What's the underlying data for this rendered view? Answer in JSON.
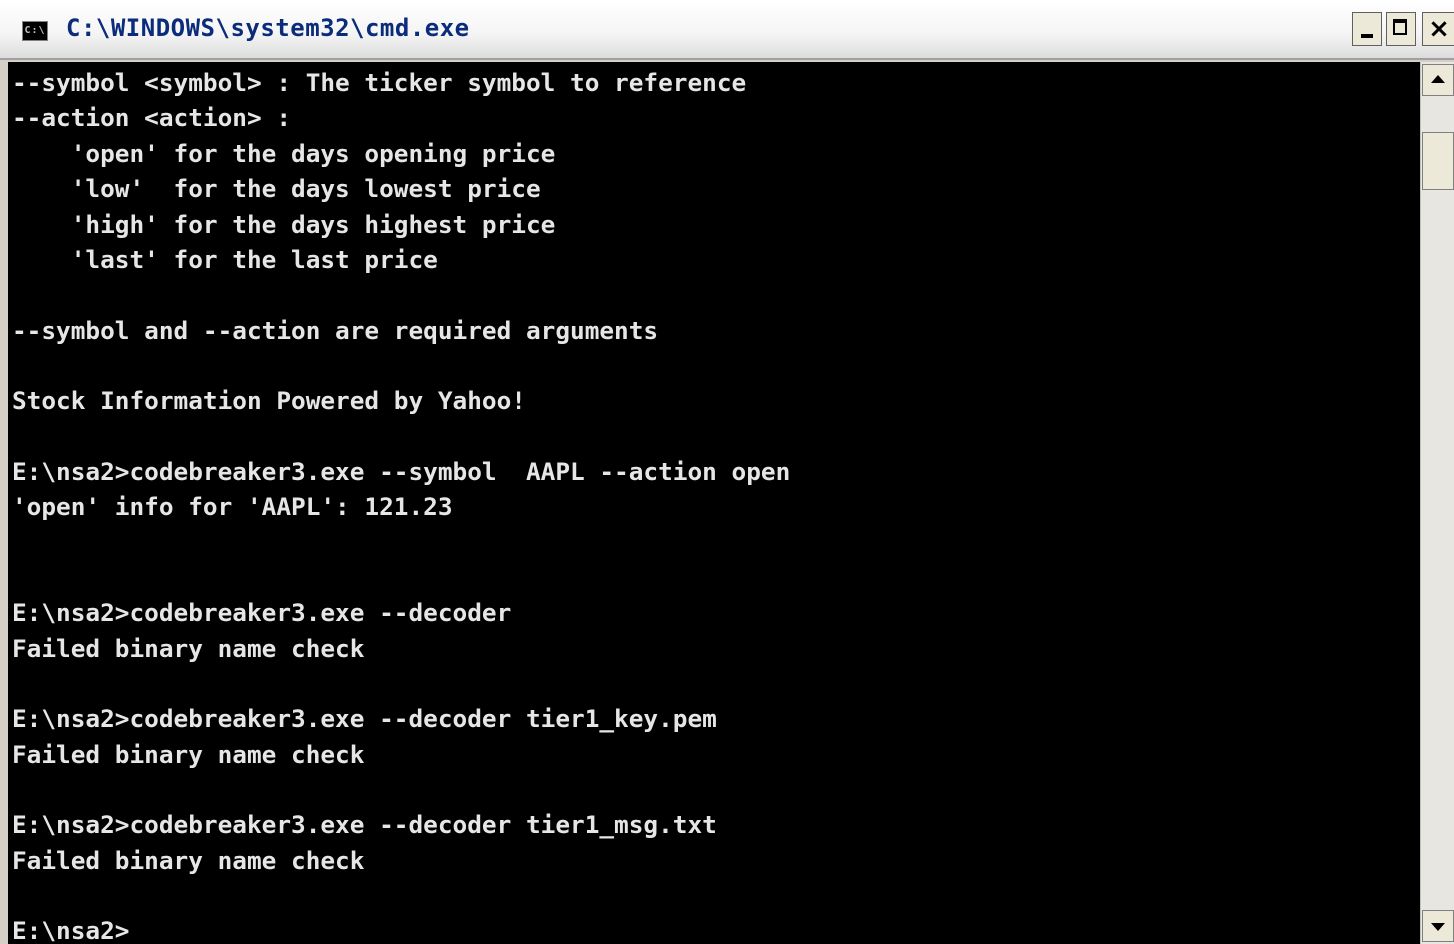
{
  "window": {
    "title": "C:\\WINDOWS\\system32\\cmd.exe",
    "icon_label": "C:\\",
    "close_label": "×"
  },
  "console": {
    "lines": [
      "--symbol <symbol> : The ticker symbol to reference",
      "--action <action> :",
      "    'open' for the days opening price",
      "    'low'  for the days lowest price",
      "    'high' for the days highest price",
      "    'last' for the last price",
      "",
      "--symbol and --action are required arguments",
      "",
      "Stock Information Powered by Yahoo!",
      "",
      "E:\\nsa2>codebreaker3.exe --symbol  AAPL --action open",
      "'open' info for 'AAPL': 121.23",
      "",
      "",
      "E:\\nsa2>codebreaker3.exe --decoder",
      "Failed binary name check",
      "",
      "E:\\nsa2>codebreaker3.exe --decoder tier1_key.pem",
      "Failed binary name check",
      "",
      "E:\\nsa2>codebreaker3.exe --decoder tier1_msg.txt",
      "Failed binary name check",
      "",
      "E:\\nsa2>"
    ]
  },
  "colors": {
    "console_background": "#000000",
    "console_text": "#e6e6e6",
    "title_text": "#0a2c7a"
  },
  "icons": {
    "app": "cmd-app-icon",
    "minimize": "minimize-icon",
    "maximize": "maximize-icon",
    "close": "close-icon",
    "scroll_up": "arrow-up-icon",
    "scroll_down": "arrow-down-icon"
  }
}
